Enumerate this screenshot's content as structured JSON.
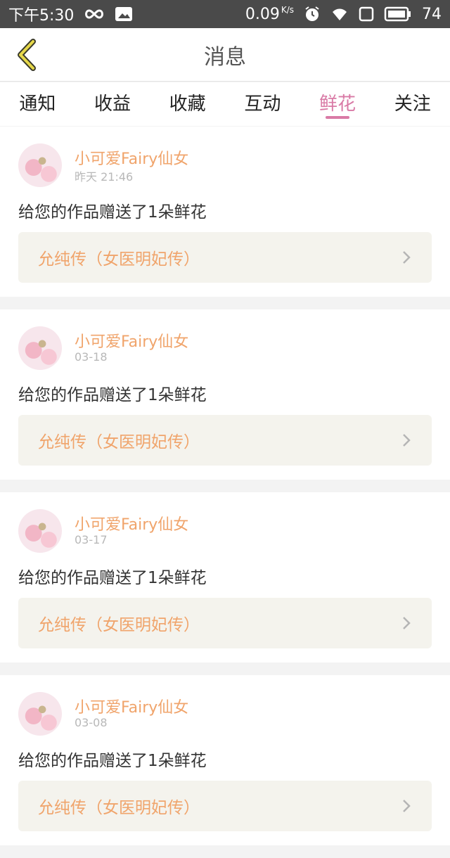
{
  "status_bar": {
    "time": "下午5:30",
    "speed": "0.09",
    "speed_unit": "K/s",
    "battery": "74"
  },
  "header": {
    "title": "消息",
    "back_icon": "chevron-left-icon"
  },
  "tabs": [
    {
      "label": "通知",
      "active": false
    },
    {
      "label": "收益",
      "active": false
    },
    {
      "label": "收藏",
      "active": false
    },
    {
      "label": "互动",
      "active": false
    },
    {
      "label": "鲜花",
      "active": true
    },
    {
      "label": "关注",
      "active": false
    }
  ],
  "colors": {
    "accent": "#d97aa6",
    "username": "#f0a46b",
    "card_bg": "#f4f3ed"
  },
  "messages": [
    {
      "user": "小可爱Fairy仙女",
      "time": "昨天 21:46",
      "text": "给您的作品赠送了1朵鲜花",
      "work": "允纯传（女医明妃传）"
    },
    {
      "user": "小可爱Fairy仙女",
      "time": "03-18",
      "text": "给您的作品赠送了1朵鲜花",
      "work": "允纯传（女医明妃传）"
    },
    {
      "user": "小可爱Fairy仙女",
      "time": "03-17",
      "text": "给您的作品赠送了1朵鲜花",
      "work": "允纯传（女医明妃传）"
    },
    {
      "user": "小可爱Fairy仙女",
      "time": "03-08",
      "text": "给您的作品赠送了1朵鲜花",
      "work": "允纯传（女医明妃传）"
    }
  ]
}
